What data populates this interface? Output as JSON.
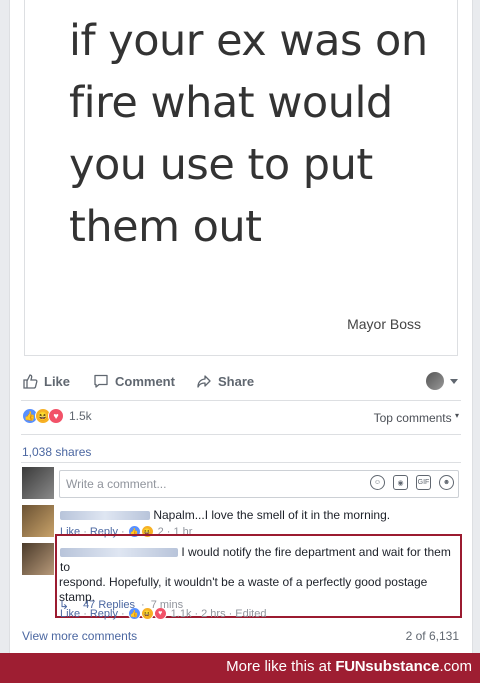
{
  "post": {
    "quote_lines": [
      "if your ex was on",
      "fire what would",
      "you use to put",
      "them out"
    ],
    "quote_author": "Mayor Boss"
  },
  "actions": {
    "like": "Like",
    "comment": "Comment",
    "share": "Share"
  },
  "reactions": {
    "count": "1.5k",
    "top_comments": "Top comments"
  },
  "shares": "1,038 shares",
  "composer": {
    "placeholder": "Write a comment...",
    "gif_label": "GIF"
  },
  "comments": [
    {
      "text": "Napalm...I love the smell of it in the morning.",
      "like": "Like",
      "reply": "Reply",
      "reaction_count": "2",
      "time": "1 hr"
    },
    {
      "text_line1": "I would notify the fire department and wait for them to",
      "text_line2": "respond. Hopefully, it wouldn't be a waste of a perfectly good postage stamp.",
      "like": "Like",
      "reply": "Reply",
      "reaction_count": "1.1k",
      "time": "2 hrs",
      "edited": "Edited",
      "replies": "47 Replies",
      "replies_time": "7 mins"
    }
  ],
  "view_more": "View more comments",
  "pager": "2 of 6,131",
  "footer": {
    "prefix": "More like this at ",
    "brand_fun": "FUN",
    "brand_rest": "substance",
    "brand_tld": ".com"
  },
  "colors": {
    "link": "#4b67a1",
    "footer_bg": "#9e1e32",
    "highlight": "#9b1b30"
  }
}
